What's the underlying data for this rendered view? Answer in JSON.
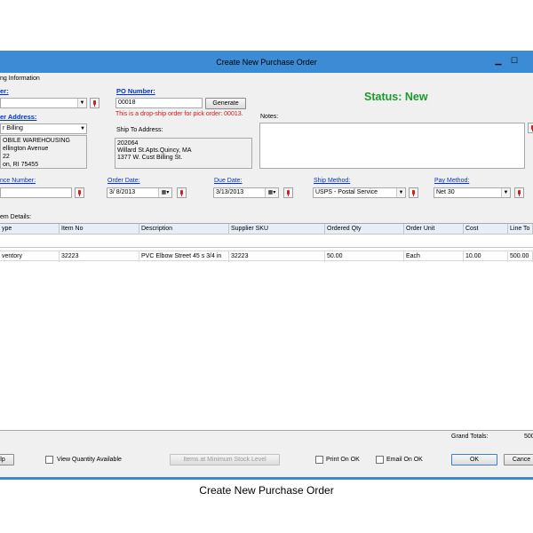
{
  "window": {
    "title": "Create New Purchase Order",
    "minimize": "▁",
    "maximize": "☐"
  },
  "header_section": {
    "label": "ng Information"
  },
  "supplier": {
    "label": "er:"
  },
  "po_number": {
    "label": "PO Number:",
    "value": "00018",
    "generate_label": "Generate"
  },
  "status": {
    "text": "Status: New",
    "color": "#1a9a2c"
  },
  "dropship_note": "This is a drop-ship order for pick order: 00013.",
  "supplier_address": {
    "label": "er Address:",
    "selected": "r Billing",
    "lines": [
      "OBILE WAREHOUSING",
      "ellington Avenue",
      "22",
      "on, RI 75455"
    ]
  },
  "ship_to": {
    "label": "Ship To Address:",
    "lines": [
      "202064",
      "Willard St.Apts.Quincy, MA",
      "1377 W. Cust Billing St."
    ]
  },
  "notes": {
    "label": "Notes:",
    "value": ""
  },
  "reference": {
    "label": "nce Number:",
    "value": ""
  },
  "order_date": {
    "label": "Order Date:",
    "value": "3/  8/2013"
  },
  "due_date": {
    "label": "Due Date:",
    "value": "3/13/2013"
  },
  "ship_method": {
    "label": "Ship Method:",
    "value": "USPS - Postal Service"
  },
  "pay_method": {
    "label": "Pay Method:",
    "value": "Net 30"
  },
  "items_section": {
    "label": "em Details:"
  },
  "grid": {
    "columns": [
      "ype",
      "Item No",
      "Description",
      "Supplier SKU",
      "Ordered Qty",
      "Order Unit",
      "Cost",
      "Line To"
    ],
    "rows": [
      [
        "ventory",
        "32223",
        "PVC Elbow Street 45 s  3/4 in",
        "32223",
        "50.00",
        "Each",
        "10.00",
        "500.00"
      ]
    ]
  },
  "totals": {
    "label": "Grand Totals:",
    "value": "500"
  },
  "footer": {
    "help_label": "lp",
    "view_qty_label": "View Quantity Available",
    "min_stock_label": "Items at Minimum Stock Level",
    "print_label": "Print On OK",
    "email_label": "Email On OK",
    "ok_label": "OK",
    "cancel_label": "Cance"
  },
  "caption": "Create New Purchase Order"
}
